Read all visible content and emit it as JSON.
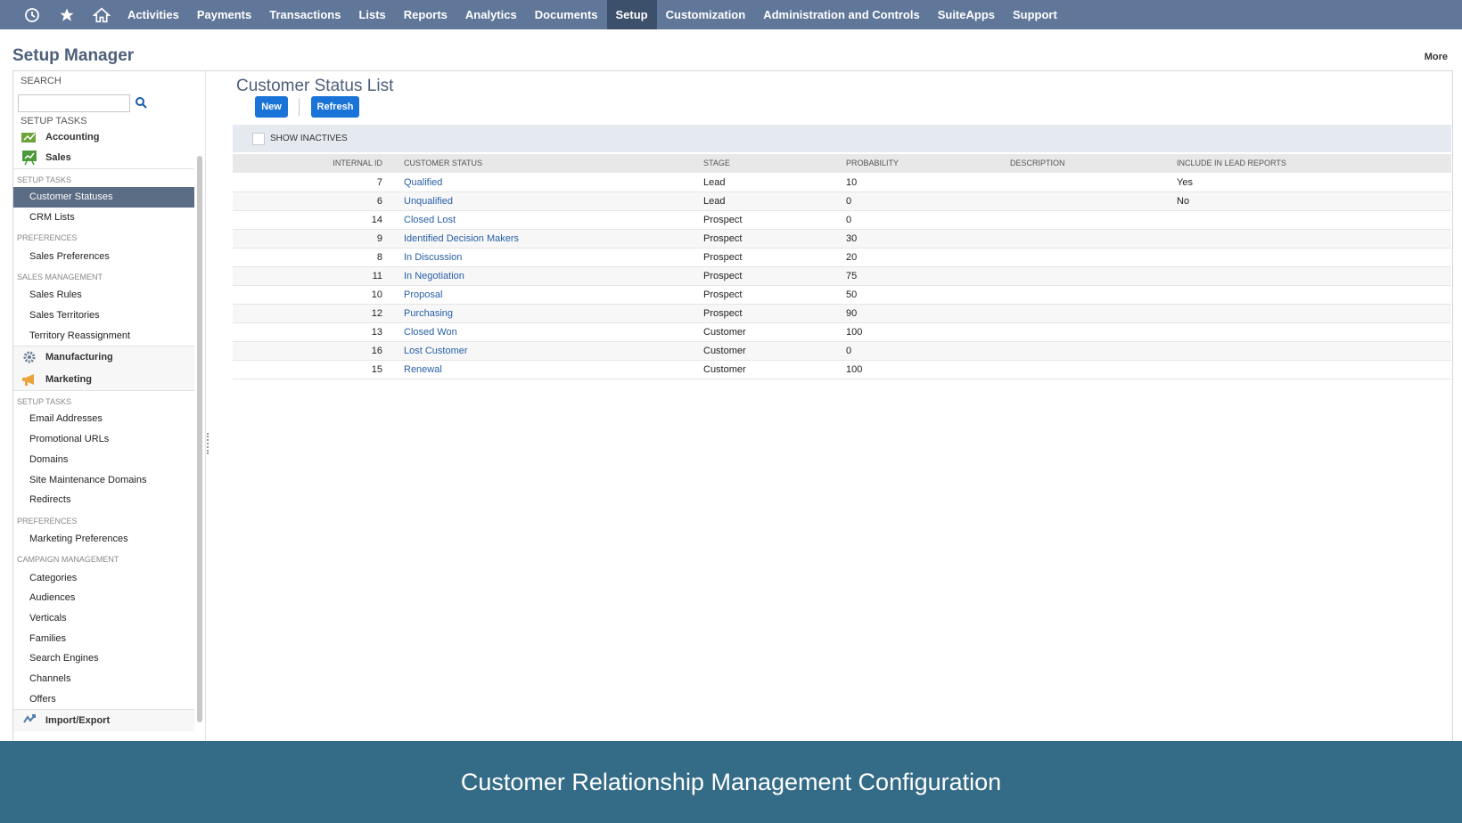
{
  "nav": {
    "icons": [
      "history-icon",
      "star-icon",
      "home-icon"
    ],
    "items": [
      "Activities",
      "Payments",
      "Transactions",
      "Lists",
      "Reports",
      "Analytics",
      "Documents",
      "Setup",
      "Customization",
      "Administration and Controls",
      "SuiteApps",
      "Support"
    ],
    "active": "Setup"
  },
  "header": {
    "title": "Setup Manager",
    "more": "More"
  },
  "sidebar": {
    "search_label": "SEARCH",
    "setup_tasks_label": "SETUP TASKS",
    "accounting": "Accounting",
    "sales": "Sales",
    "sales_sections": {
      "setup_tasks": "SETUP TASKS",
      "preferences": "PREFERENCES",
      "sales_management": "SALES MANAGEMENT"
    },
    "sales_items": {
      "customer_statuses": "Customer Statuses",
      "crm_lists": "CRM Lists",
      "sales_preferences": "Sales Preferences",
      "sales_rules": "Sales Rules",
      "sales_territories": "Sales Territories",
      "territory_reassignment": "Territory Reassignment"
    },
    "manufacturing": "Manufacturing",
    "marketing": "Marketing",
    "marketing_sections": {
      "setup_tasks": "SETUP TASKS",
      "preferences": "PREFERENCES",
      "campaign_management": "CAMPAIGN MANAGEMENT"
    },
    "marketing_items": {
      "email_addresses": "Email Addresses",
      "promotional_urls": "Promotional URLs",
      "domains": "Domains",
      "site_maintenance_domains": "Site Maintenance Domains",
      "redirects": "Redirects",
      "marketing_preferences": "Marketing Preferences",
      "categories": "Categories",
      "audiences": "Audiences",
      "verticals": "Verticals",
      "families": "Families",
      "search_engines": "Search Engines",
      "channels": "Channels",
      "offers": "Offers"
    },
    "import_export": "Import/Export"
  },
  "main": {
    "title": "Customer Status List",
    "new_button": "New",
    "refresh_button": "Refresh",
    "show_inactives": "SHOW INACTIVES",
    "show_inactives_checked": false,
    "columns": {
      "internal_id": "INTERNAL ID",
      "customer_status": "CUSTOMER STATUS",
      "stage": "STAGE",
      "probability": "PROBABILITY",
      "description": "DESCRIPTION",
      "include_in_lead_reports": "INCLUDE IN LEAD REPORTS"
    },
    "rows": [
      {
        "id": "7",
        "status": "Qualified",
        "stage": "Lead",
        "probability": "10",
        "description": "",
        "lead": "Yes"
      },
      {
        "id": "6",
        "status": "Unqualified",
        "stage": "Lead",
        "probability": "0",
        "description": "",
        "lead": "No"
      },
      {
        "id": "14",
        "status": "Closed Lost",
        "stage": "Prospect",
        "probability": "0",
        "description": "",
        "lead": ""
      },
      {
        "id": "9",
        "status": "Identified Decision Makers",
        "stage": "Prospect",
        "probability": "30",
        "description": "",
        "lead": ""
      },
      {
        "id": "8",
        "status": "In Discussion",
        "stage": "Prospect",
        "probability": "20",
        "description": "",
        "lead": ""
      },
      {
        "id": "11",
        "status": "In Negotiation",
        "stage": "Prospect",
        "probability": "75",
        "description": "",
        "lead": ""
      },
      {
        "id": "10",
        "status": "Proposal",
        "stage": "Prospect",
        "probability": "50",
        "description": "",
        "lead": ""
      },
      {
        "id": "12",
        "status": "Purchasing",
        "stage": "Prospect",
        "probability": "90",
        "description": "",
        "lead": ""
      },
      {
        "id": "13",
        "status": "Closed Won",
        "stage": "Customer",
        "probability": "100",
        "description": "",
        "lead": ""
      },
      {
        "id": "16",
        "status": "Lost Customer",
        "stage": "Customer",
        "probability": "0",
        "description": "",
        "lead": ""
      },
      {
        "id": "15",
        "status": "Renewal",
        "stage": "Customer",
        "probability": "100",
        "description": "",
        "lead": ""
      }
    ]
  },
  "footer": {
    "caption": "Customer Relationship Management Configuration"
  },
  "colors": {
    "nav_bg": "#607799",
    "nav_active": "#3c4f6b",
    "button": "#1a74d8",
    "link": "#275fa6",
    "footer_bg": "#346b86"
  }
}
